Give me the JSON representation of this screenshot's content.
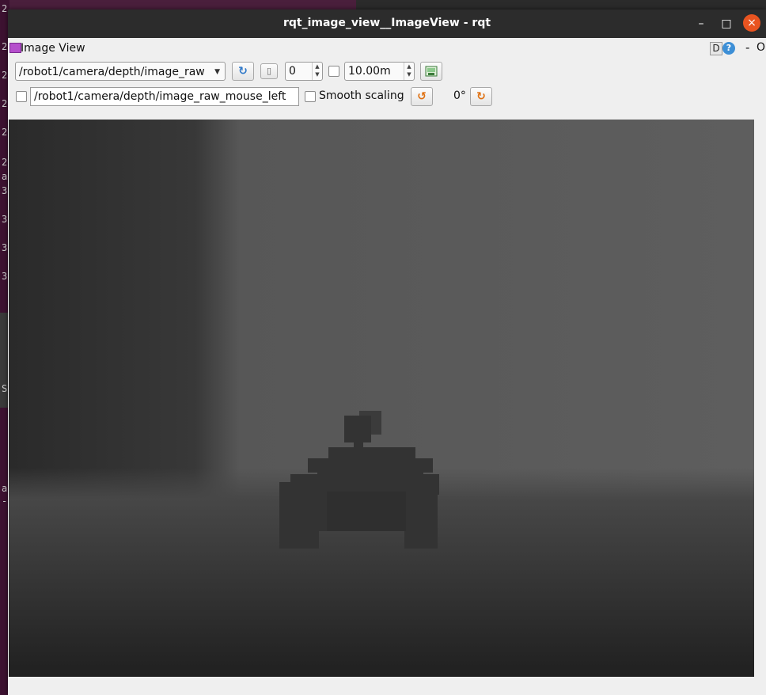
{
  "window": {
    "title": "rqt_image_view__ImageView - rqt",
    "minimize_glyph": "–",
    "maximize_glyph": "□",
    "close_glyph": "×"
  },
  "plugin": {
    "title": "Image View",
    "d_label": "D",
    "help_label": "?",
    "dash_label": "-",
    "o_label": "O"
  },
  "toolbar": {
    "topic_selected": "/robot1/camera/depth/image_raw",
    "refresh_icon": "refresh-icon",
    "zoom_icon": "fit-zoom-icon",
    "zero_value": "0",
    "max_range_checked": false,
    "max_range_value": "10.00m",
    "save_icon": "save-image-icon",
    "mouse_publish_checked": false,
    "mouse_topic_value": "/robot1/camera/depth/image_raw_mouse_left",
    "smooth_scaling_checked": false,
    "smooth_scaling_label": "Smooth scaling",
    "rotate_left_icon": "rotate-left-icon",
    "rotation_label": "0°",
    "rotate_right_icon": "rotate-right-icon"
  },
  "background": {
    "terminal_glyphs": [
      "2",
      "2",
      "2",
      "2",
      "2",
      "2",
      "2",
      "a",
      "3",
      "3",
      "3",
      "3",
      "S",
      "a",
      "-"
    ]
  },
  "colors": {
    "titlebar": "#2c2c2c",
    "close_button": "#e95420",
    "window_bg": "#efefef",
    "desktop": "#3d1231"
  }
}
